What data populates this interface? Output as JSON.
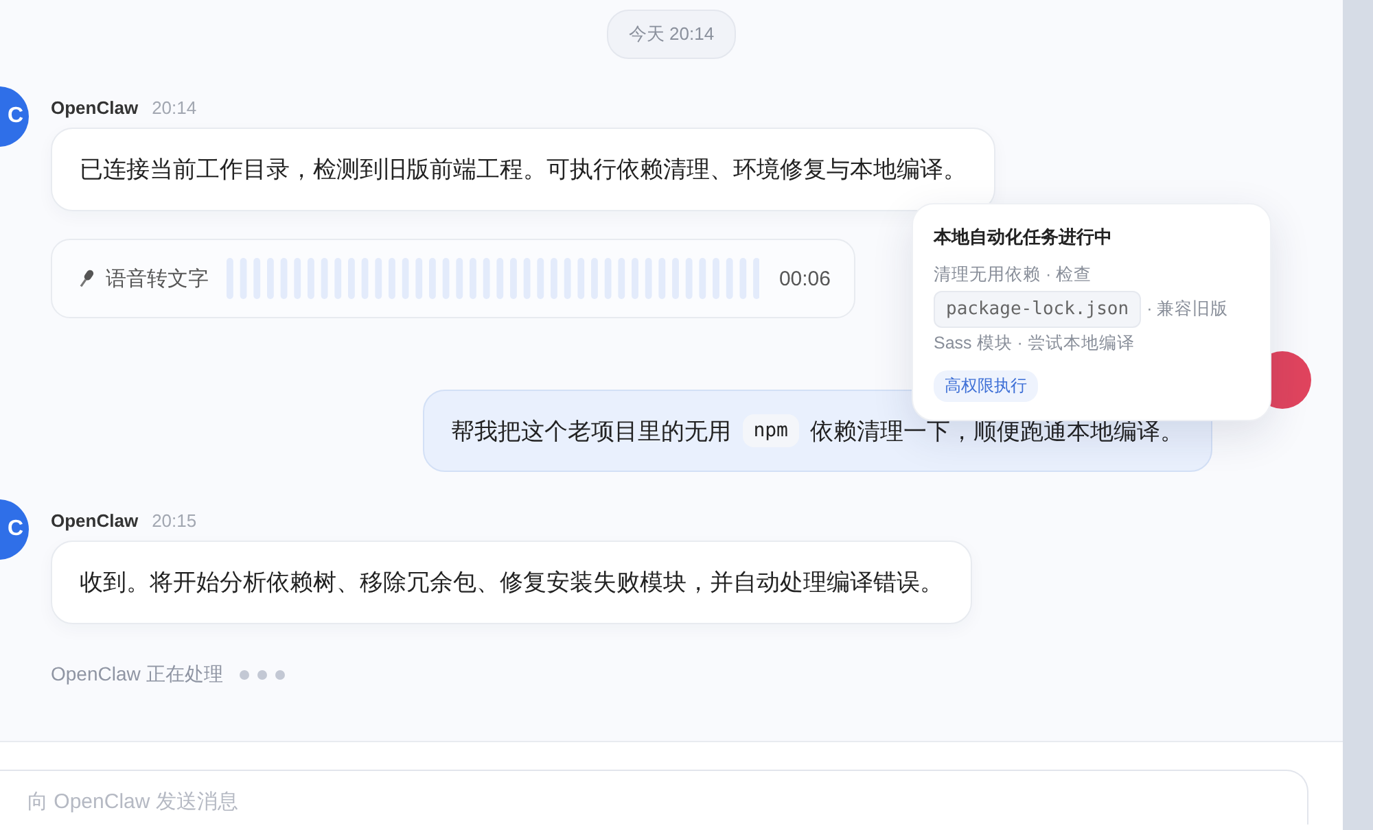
{
  "date_divider": "今天 20:14",
  "messages": [
    {
      "kind": "bot",
      "avatar": "C",
      "sender": "OpenClaw",
      "time": "20:14",
      "text": "已连接当前工作目录，检测到旧版前端工程。可执行依赖清理、环境修复与本地编译。"
    },
    {
      "kind": "voice",
      "label": "语音转文字",
      "duration": "00:06"
    },
    {
      "kind": "user",
      "parts": [
        {
          "kind": "text",
          "text": "帮我把这个老项目里的无用"
        },
        {
          "kind": "code",
          "text": "npm"
        },
        {
          "kind": "text",
          "text": "依赖清理一下，顺便跑通本地编译。"
        }
      ]
    },
    {
      "kind": "bot",
      "avatar": "C",
      "sender": "OpenClaw",
      "time": "20:15",
      "text": "收到。将开始分析依赖树、移除冗余包、修复安装失败模块，并自动处理编译错误。"
    }
  ],
  "typing": {
    "text": "OpenClaw 正在处理"
  },
  "task_popup": {
    "title": "本地自动化任务进行中",
    "lines": [
      {
        "parts": [
          {
            "kind": "text",
            "text": "清理无用依赖 · 检查"
          }
        ]
      },
      {
        "parts": [
          {
            "kind": "code",
            "text": "package-lock.json"
          },
          {
            "kind": "text",
            "text": "· 兼容旧版"
          }
        ]
      },
      {
        "parts": [
          {
            "kind": "text",
            "text": "Sass 模块 · 尝试本地编译"
          }
        ]
      }
    ],
    "badge": "高权限执行"
  },
  "composer": {
    "placeholder": "向 OpenClaw 发送消息"
  }
}
